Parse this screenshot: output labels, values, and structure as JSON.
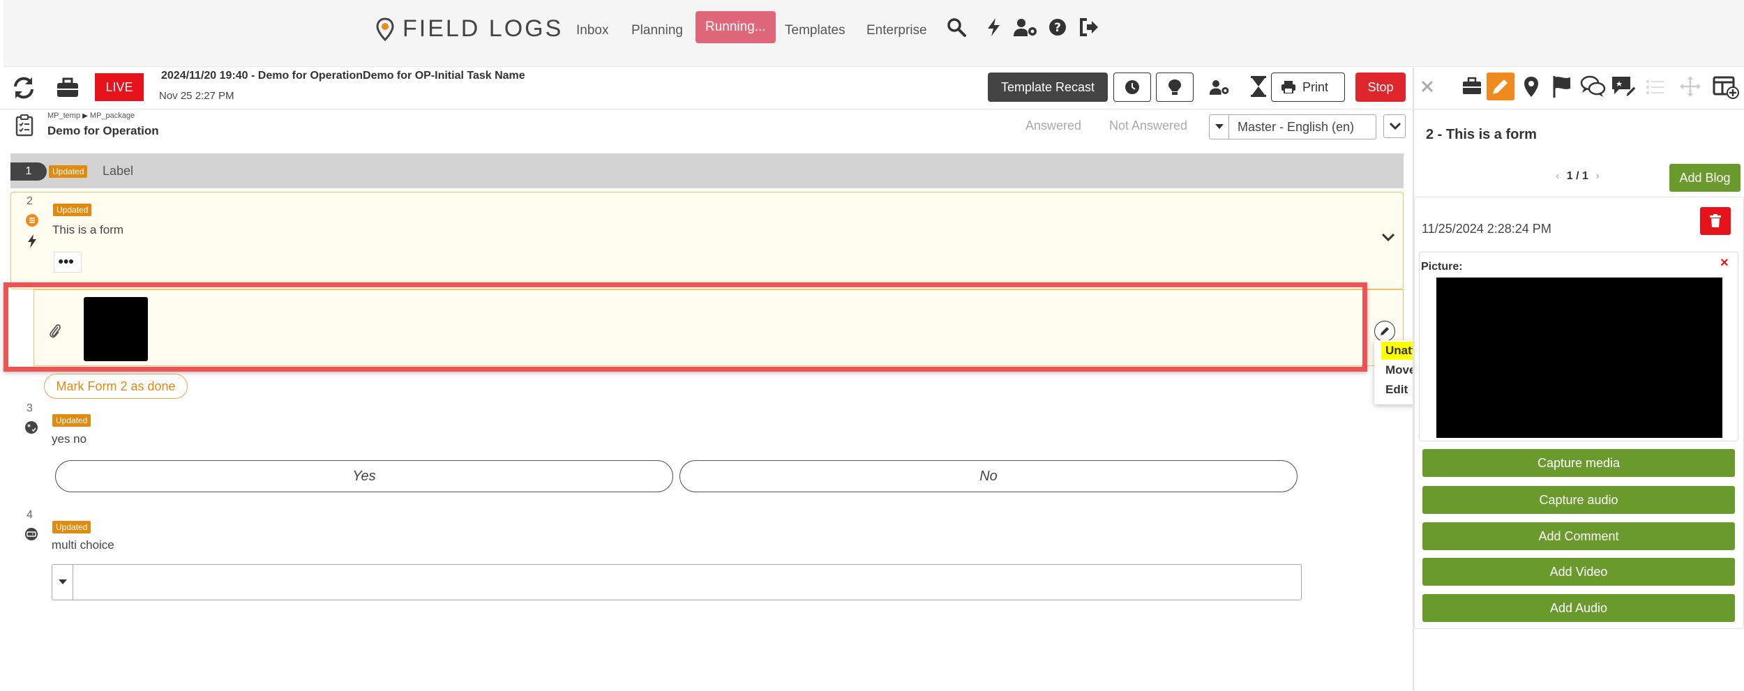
{
  "app": {
    "logo_text": "FIELD LOGS"
  },
  "nav": {
    "items": [
      "Inbox",
      "Planning",
      "Running...",
      "Templates",
      "Enterprise"
    ]
  },
  "task": {
    "live_label": "LIVE",
    "title": "2024/11/20 19:40 - Demo for OperationDemo for OP-Initial Task Name",
    "date": "Nov 25 2:27 PM",
    "template_recast_label": "Template Recast",
    "print_label": "Print",
    "stop_label": "Stop"
  },
  "breadcrumb": {
    "path": [
      "MP_temp",
      "MP_package"
    ],
    "title": "Demo for Operation"
  },
  "filters": {
    "answered": "Answered",
    "not_answered": "Not Answered"
  },
  "language": {
    "selected": "Master - English (en)"
  },
  "items": [
    {
      "number": "1",
      "badge": "Updated",
      "label": "Label"
    },
    {
      "number": "2",
      "badge": "Updated",
      "label": "This is a form"
    },
    {
      "number": "3",
      "badge": "Updated",
      "label": "yes no"
    },
    {
      "number": "4",
      "badge": "Updated",
      "label": "multi choice"
    }
  ],
  "form2": {
    "mark_done_label": "Mark Form 2 as done",
    "more_label": "●●●"
  },
  "yes_no": {
    "yes": "Yes",
    "no": "No"
  },
  "context_menu": {
    "unattach": "Unattach...",
    "move": "Move...",
    "edit": "Edit"
  },
  "right_panel": {
    "title": "2 - This is a form",
    "pager": "1 / 1",
    "add_blog_label": "Add Blog",
    "blog_date": "11/25/2024 2:28:24 PM",
    "picture_label": "Picture:",
    "picture_close": "×",
    "buttons": [
      "Capture media",
      "Capture audio",
      "Add Comment",
      "Add Video",
      "Add Audio"
    ]
  },
  "colors": {
    "accent_orange": "#ee8a1e",
    "running_pink": "#e0667a",
    "live_red": "#e8121b",
    "green": "#6a9a2c",
    "highlight_red": "#ee5454",
    "menu_highlight": "#ffff00"
  }
}
